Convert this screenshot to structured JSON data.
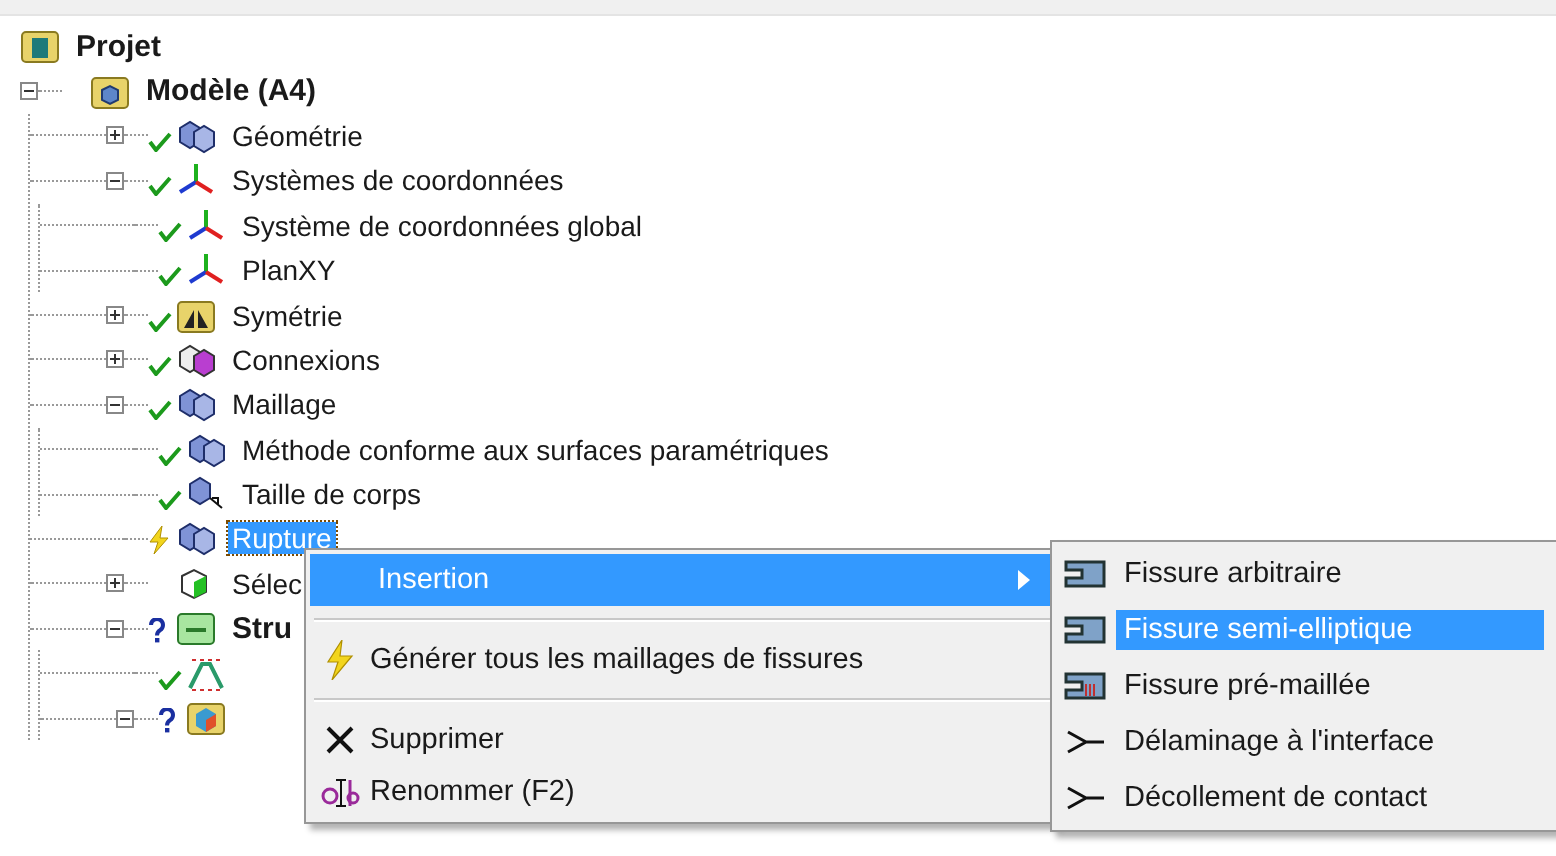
{
  "tree": {
    "label": "Projet",
    "kind": "project",
    "selected": false,
    "children": [
      {
        "label": "Modèle (A4)",
        "kind": "model",
        "selected": false,
        "expanded": true,
        "done": false,
        "needs_update": false,
        "incomplete": false,
        "children": [
          {
            "label": "Géométrie",
            "kind": "cube",
            "done": true,
            "needs_update": false,
            "incomplete": false,
            "selected": false,
            "expanded": false
          },
          {
            "label": "Systèmes de coordonnées",
            "kind": "axes",
            "done": true,
            "needs_update": false,
            "incomplete": false,
            "selected": false,
            "expanded": true,
            "children": [
              {
                "label": "Système de coordonnées global",
                "kind": "axes",
                "done": true,
                "needs_update": false,
                "incomplete": false,
                "selected": false
              },
              {
                "label": "PlanXY",
                "kind": "axes",
                "done": true,
                "needs_update": false,
                "incomplete": false,
                "selected": false
              }
            ]
          },
          {
            "label": "Symétrie",
            "kind": "symmetry",
            "done": true,
            "needs_update": false,
            "incomplete": false,
            "selected": false,
            "expanded": false
          },
          {
            "label": "Connexions",
            "kind": "connections",
            "done": true,
            "needs_update": false,
            "incomplete": false,
            "selected": false,
            "expanded": false
          },
          {
            "label": "Maillage",
            "kind": "cube",
            "done": true,
            "needs_update": false,
            "incomplete": false,
            "selected": false,
            "expanded": true,
            "children": [
              {
                "label": "Méthode conforme aux surfaces paramétriques",
                "kind": "cube",
                "done": true,
                "needs_update": false,
                "incomplete": false,
                "selected": false
              },
              {
                "label": "Taille de corps",
                "kind": "sizing",
                "done": true,
                "needs_update": false,
                "incomplete": false,
                "selected": false
              }
            ]
          },
          {
            "label": "Rupture",
            "kind": "cube",
            "done": false,
            "needs_update": true,
            "incomplete": false,
            "selected": true
          },
          {
            "label": "Sélec",
            "kind": "selection",
            "done": false,
            "needs_update": false,
            "incomplete": false,
            "selected": false,
            "expanded": false
          },
          {
            "label": "Stru",
            "kind": "analysis",
            "done": false,
            "needs_update": false,
            "incomplete": true,
            "selected": false,
            "expanded": true,
            "children": [
              {
                "kind": "settings",
                "done": true,
                "needs_update": false,
                "incomplete": false,
                "selected": false
              },
              {
                "kind": "solution",
                "done": false,
                "needs_update": false,
                "incomplete": true,
                "selected": false,
                "expanded": true
              }
            ]
          }
        ]
      }
    ]
  },
  "context_menu": {
    "items": [
      {
        "kind": "submenu",
        "label": "Insertion",
        "selected": true
      },
      {
        "kind": "separator"
      },
      {
        "kind": "item",
        "label": "Générer tous les maillages de fissures",
        "selected": false
      },
      {
        "kind": "separator"
      },
      {
        "kind": "item",
        "label": "Supprimer",
        "selected": false
      },
      {
        "kind": "item",
        "label": "Renommer (F2)",
        "selected": false
      }
    ]
  },
  "submenu": {
    "items": [
      {
        "label": "Fissure arbitraire",
        "selected": false
      },
      {
        "label": "Fissure semi-elliptique",
        "selected": true
      },
      {
        "label": "Fissure pré-maillée",
        "selected": false
      },
      {
        "label": "Délaminage à l'interface",
        "selected": false
      },
      {
        "label": "Décollement de contact",
        "selected": false
      }
    ]
  }
}
